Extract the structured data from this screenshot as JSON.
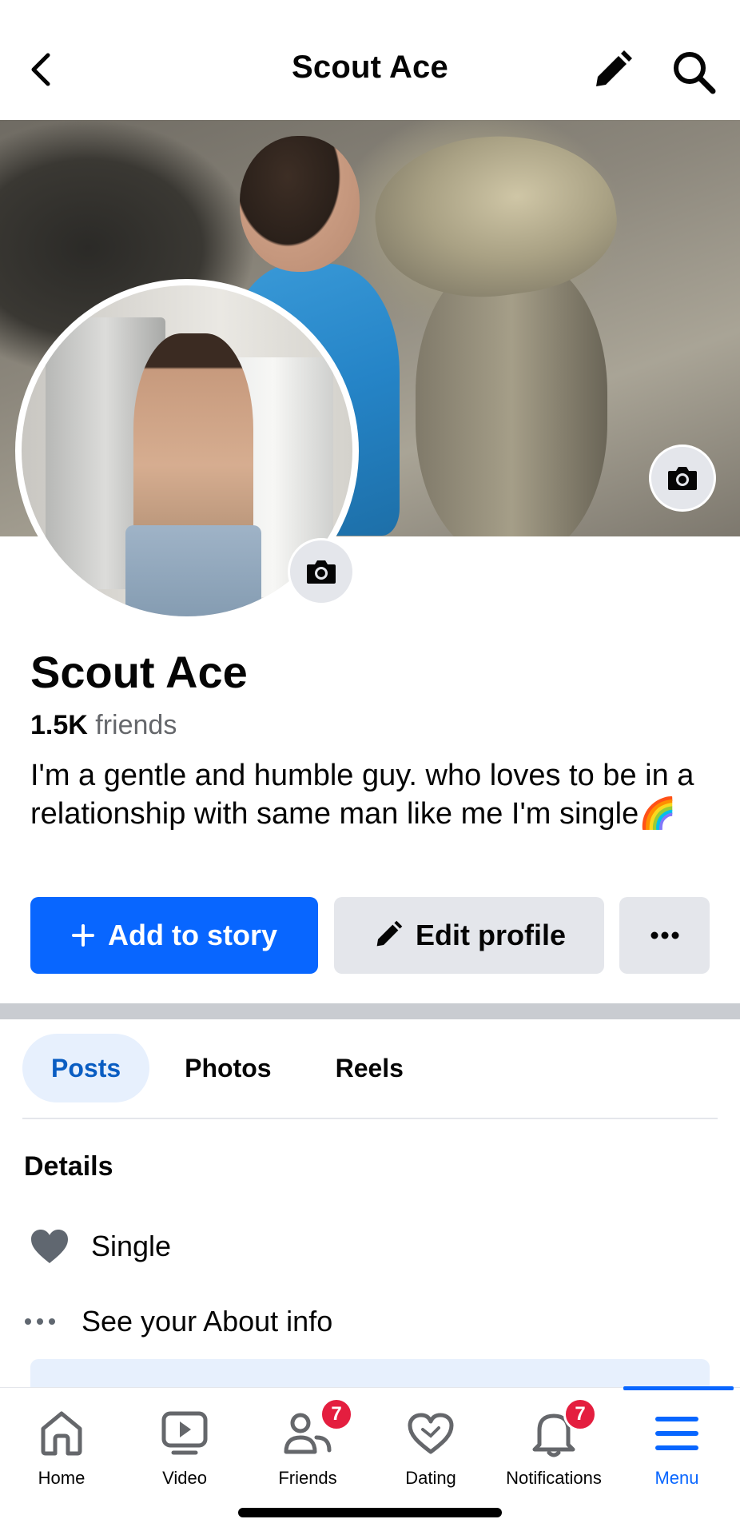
{
  "header": {
    "title": "Scout Ace",
    "back_icon": "chevron-left-icon",
    "edit_icon": "pencil-icon",
    "search_icon": "search-icon"
  },
  "profile": {
    "name": "Scout Ace",
    "friends_count": "1.5K",
    "friends_label": "friends",
    "bio": "I'm a gentle and humble guy. who loves to be in a relationship with same man like me I'm single🌈"
  },
  "actions": {
    "add_story_label": "Add to story",
    "edit_profile_label": "Edit profile",
    "more_label": "···"
  },
  "tabs": [
    {
      "label": "Posts",
      "active": true
    },
    {
      "label": "Photos",
      "active": false
    },
    {
      "label": "Reels",
      "active": false
    }
  ],
  "details": {
    "title": "Details",
    "relationship": "Single",
    "about_link": "See your About info"
  },
  "nav": [
    {
      "label": "Home",
      "icon": "home-icon"
    },
    {
      "label": "Video",
      "icon": "video-icon"
    },
    {
      "label": "Friends",
      "icon": "friends-icon",
      "badge": "7"
    },
    {
      "label": "Dating",
      "icon": "heart-icon"
    },
    {
      "label": "Notifications",
      "icon": "bell-icon",
      "badge": "7"
    },
    {
      "label": "Menu",
      "icon": "menu-icon",
      "active": true
    }
  ],
  "colors": {
    "primary": "#0866ff",
    "badge": "#e41e3f",
    "tab_active_bg": "#e7f0fd",
    "button_gray": "#e4e6eb"
  }
}
